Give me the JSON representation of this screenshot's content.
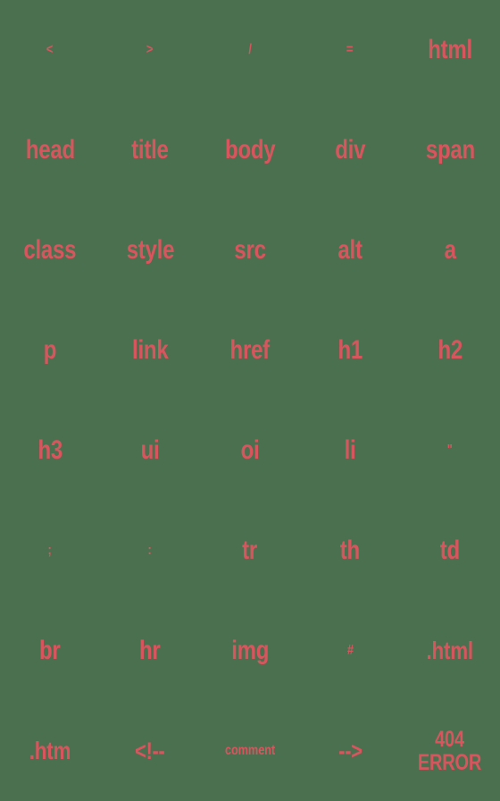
{
  "sheet": {
    "title": "HTML tag emoji sticker sheet",
    "background_color": "#4a7050",
    "text_color": "#d9555e",
    "columns": 5,
    "rows": 8
  },
  "stickers": [
    {
      "label": "<",
      "name": "sticker-less-than",
      "size": "sym"
    },
    {
      "label": ">",
      "name": "sticker-greater-than",
      "size": "sym"
    },
    {
      "label": "/",
      "name": "sticker-slash",
      "size": "slash"
    },
    {
      "label": "=",
      "name": "sticker-equals",
      "size": "sym"
    },
    {
      "label": "html",
      "name": "sticker-html",
      "size": "xl"
    },
    {
      "label": "head",
      "name": "sticker-head",
      "size": "xl"
    },
    {
      "label": "title",
      "name": "sticker-title",
      "size": "xl"
    },
    {
      "label": "body",
      "name": "sticker-body",
      "size": "xl"
    },
    {
      "label": "div",
      "name": "sticker-div",
      "size": "xl"
    },
    {
      "label": "span",
      "name": "sticker-span",
      "size": "xl"
    },
    {
      "label": "class",
      "name": "sticker-class",
      "size": "xl"
    },
    {
      "label": "style",
      "name": "sticker-style",
      "size": "xl"
    },
    {
      "label": "src",
      "name": "sticker-src",
      "size": "xl"
    },
    {
      "label": "alt",
      "name": "sticker-alt",
      "size": "xl"
    },
    {
      "label": "a",
      "name": "sticker-a",
      "size": "xl"
    },
    {
      "label": "p",
      "name": "sticker-p",
      "size": "xl"
    },
    {
      "label": "link",
      "name": "sticker-link",
      "size": "xl"
    },
    {
      "label": "href",
      "name": "sticker-href",
      "size": "xl"
    },
    {
      "label": "h1",
      "name": "sticker-h1",
      "size": "xl"
    },
    {
      "label": "h2",
      "name": "sticker-h2",
      "size": "xl"
    },
    {
      "label": "h3",
      "name": "sticker-h3",
      "size": "xl"
    },
    {
      "label": "ui",
      "name": "sticker-ui",
      "size": "xl"
    },
    {
      "label": "oi",
      "name": "sticker-oi",
      "size": "xl"
    },
    {
      "label": "li",
      "name": "sticker-li",
      "size": "xl"
    },
    {
      "label": "\"",
      "name": "sticker-double-quote",
      "size": "raise"
    },
    {
      "label": ";",
      "name": "sticker-semicolon",
      "size": "sym"
    },
    {
      "label": ":",
      "name": "sticker-colon",
      "size": "sym"
    },
    {
      "label": "tr",
      "name": "sticker-tr",
      "size": "xl"
    },
    {
      "label": "th",
      "name": "sticker-th",
      "size": "xl"
    },
    {
      "label": "td",
      "name": "sticker-td",
      "size": "xl"
    },
    {
      "label": "br",
      "name": "sticker-br",
      "size": "xl"
    },
    {
      "label": "hr",
      "name": "sticker-hr",
      "size": "xl"
    },
    {
      "label": "img",
      "name": "sticker-img",
      "size": "xl"
    },
    {
      "label": "#",
      "name": "sticker-hash",
      "size": "sym"
    },
    {
      "label": ".html",
      "name": "sticker-dot-html",
      "size": "lg"
    },
    {
      "label": ".htm",
      "name": "sticker-dot-htm",
      "size": "lg"
    },
    {
      "label": "<!--",
      "name": "sticker-comment-open",
      "size": "md"
    },
    {
      "label": "comment",
      "name": "sticker-comment-word",
      "size": "sm"
    },
    {
      "label": "-->",
      "name": "sticker-comment-close",
      "size": "md"
    },
    {
      "label": "404\nERROR",
      "name": "sticker-404-error",
      "size": "multi"
    }
  ]
}
